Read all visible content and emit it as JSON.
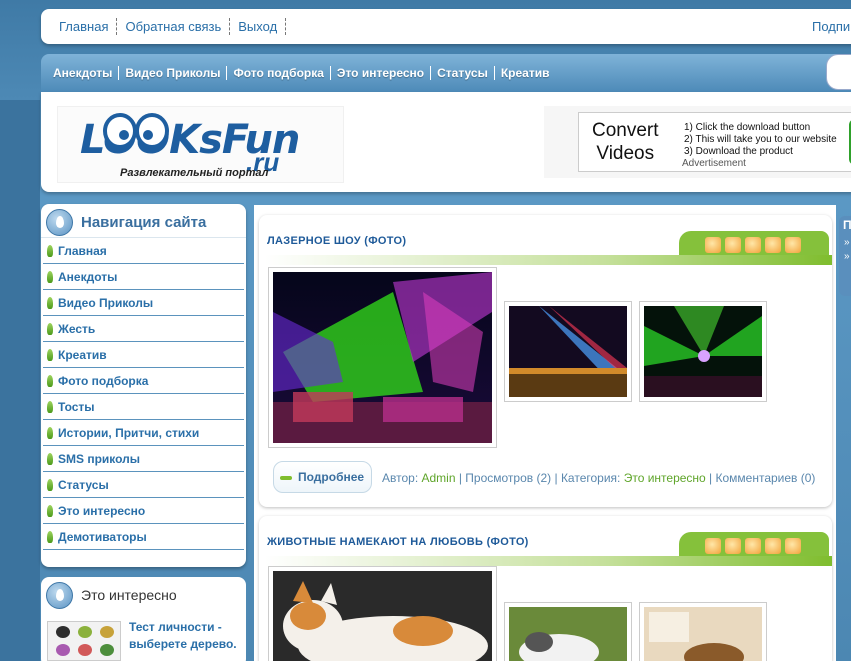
{
  "top_links": [
    "Главная",
    "Обратная связь",
    "Выход"
  ],
  "top_right": "Подпи",
  "categories": [
    "Анекдоты",
    "Видео Приколы",
    "Фото подборка",
    "Это интересно",
    "Статусы",
    "Креатив"
  ],
  "logo": {
    "text_main": "LOOKsFun",
    "text_ru": ".ru",
    "tagline": "Развлекательный портал"
  },
  "ad": {
    "title_line1": "Convert",
    "title_line2": "Videos",
    "step1": "1) Click the download button",
    "step2": "2) This will take you to our website",
    "step3": "3) Download the product",
    "label": "Advertisement"
  },
  "nav": {
    "title": "Навигация сайта",
    "items": [
      "Главная",
      "Анекдоты",
      "Видео Приколы",
      "Жесть",
      "Креатив",
      "Фото подборка",
      "Тосты",
      "Истории, Притчи, стихи",
      "SMS приколы",
      "Статусы",
      "Это интересно",
      "Демотиваторы"
    ]
  },
  "box2": {
    "title": "Это интересно",
    "line1": "Тест личности -",
    "line2": "выберете дерево."
  },
  "posts": [
    {
      "title": "ЛАЗЕРНОЕ ШОУ (ФОТО)",
      "more": "Подробнее",
      "meta": {
        "author_label": "Автор: ",
        "author": "Admin",
        "views": " | Просмотров (2) | ",
        "cat_label": "Категория: ",
        "cat": "Это интересно",
        "comments": " | Комментариев (0)"
      }
    },
    {
      "title": "ЖИВОТНЫЕ НАМЕКАЮТ НА ЛЮБОВЬ (ФОТО)"
    }
  ],
  "right_box": {
    "letter": "П",
    "bullet": "»"
  },
  "colors": {
    "page_bg": "#4f8bb6",
    "link": "#2a6fa8",
    "accent_green": "#7fbd2e"
  }
}
